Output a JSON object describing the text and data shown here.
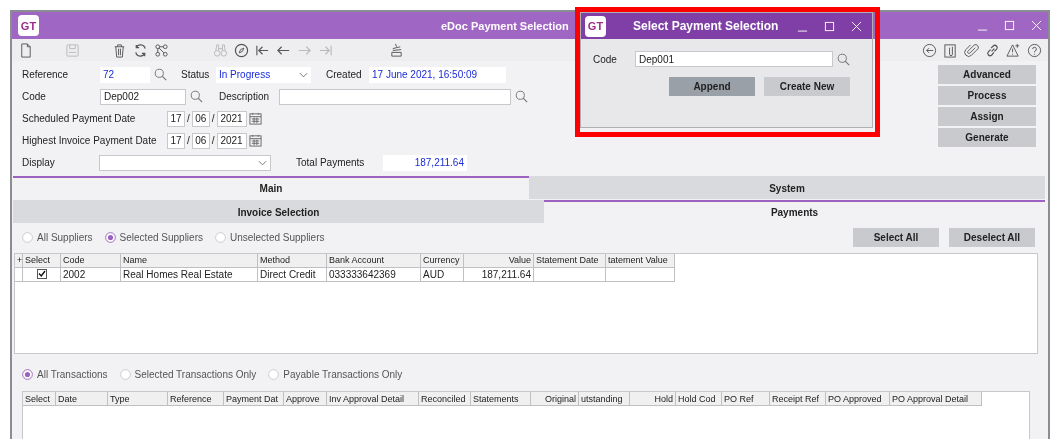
{
  "window": {
    "logo": "GT",
    "title": "eDoc Payment Selection"
  },
  "toolbar": {
    "left_groups": [
      [
        {
          "kind": "new-document",
          "disabled": false
        }
      ],
      [
        {
          "kind": "save",
          "disabled": true
        }
      ],
      [
        {
          "kind": "trash",
          "disabled": false
        },
        {
          "kind": "refresh",
          "disabled": false
        },
        {
          "kind": "workflow",
          "disabled": false
        }
      ],
      [
        {
          "kind": "binoculars",
          "disabled": true
        },
        {
          "kind": "compass",
          "disabled": false
        },
        {
          "kind": "first",
          "disabled": false
        },
        {
          "kind": "previous",
          "disabled": false
        },
        {
          "kind": "next",
          "disabled": true
        },
        {
          "kind": "last",
          "disabled": true
        }
      ],
      [
        {
          "kind": "stack",
          "disabled": false
        }
      ]
    ],
    "right": [
      {
        "kind": "back",
        "disabled": false
      },
      {
        "kind": "document-clip",
        "disabled": false
      },
      {
        "kind": "paperclip",
        "disabled": false
      },
      {
        "kind": "link",
        "disabled": false
      },
      {
        "kind": "warning",
        "disabled": false
      },
      {
        "kind": "help",
        "disabled": false
      }
    ]
  },
  "form": {
    "reference": {
      "label": "Reference",
      "value": "72"
    },
    "status": {
      "label": "Status",
      "value": "In Progress"
    },
    "created": {
      "label": "Created",
      "value": "17 June 2021, 16:50:09"
    },
    "code": {
      "label": "Code",
      "value": "Dep002"
    },
    "description": {
      "label": "Description"
    },
    "dates": [
      {
        "label": "Scheduled Payment Date",
        "day": "17",
        "month": "06",
        "year": "2021",
        "separators": [
          "/",
          "/"
        ]
      },
      {
        "label": "Highest Invoice Payment Date",
        "day": "17",
        "month": "06",
        "year": "2021",
        "separators": [
          "/",
          "/"
        ]
      }
    ],
    "display": {
      "label": "Display"
    },
    "total_payments": {
      "label": "Total Payments",
      "value": "187,211.64"
    }
  },
  "actions": [
    "Advanced",
    "Process",
    "Assign",
    "Generate"
  ],
  "tabs_top": [
    {
      "label": "Main",
      "selected": true
    },
    {
      "label": "System",
      "selected": false
    }
  ],
  "tabs_sub": [
    {
      "label": "Invoice Selection",
      "selected": false
    },
    {
      "label": "Payments",
      "selected": true
    }
  ],
  "supplier_filter": [
    {
      "label": "All Suppliers",
      "selected": false
    },
    {
      "label": "Selected Suppliers",
      "selected": true
    },
    {
      "label": "Unselected Suppliers",
      "selected": false
    }
  ],
  "selection_buttons": [
    "Select All",
    "Deselect All"
  ],
  "suppliers_table": {
    "columns": [
      "+",
      "Select",
      "Code",
      "Name",
      "Method",
      "Bank Account",
      "Currency",
      "Value",
      "Statement Date",
      "tatement Value"
    ],
    "rows": [
      {
        "checked": true,
        "cells": [
          "",
          "",
          "2002",
          "Real Homes Real Estate",
          "Direct Credit",
          "033333642369",
          "AUD",
          "187,211.64",
          "",
          ""
        ]
      }
    ]
  },
  "transaction_filter": [
    {
      "label": "All Transactions",
      "selected": true
    },
    {
      "label": "Selected Transactions Only",
      "selected": false
    },
    {
      "label": "Payable Transactions Only",
      "selected": false
    }
  ],
  "transactions_table": {
    "columns": [
      "Select",
      "Date",
      "Type",
      "Reference",
      "Payment Dat",
      "Approve",
      "Inv Approval Detail",
      "Reconciled",
      "Statements",
      "Original",
      "utstanding",
      "Hold",
      "Hold Cod",
      "PO Ref",
      "Receipt Ref",
      "PO Approved",
      "PO Approval Detail"
    ]
  },
  "dialog": {
    "logo": "GT",
    "title": "Select Payment Selection",
    "code_label": "Code",
    "code_value": "Dep001",
    "buttons": [
      {
        "label": "Append",
        "default": true
      },
      {
        "label": "Create New",
        "default": false
      }
    ]
  }
}
